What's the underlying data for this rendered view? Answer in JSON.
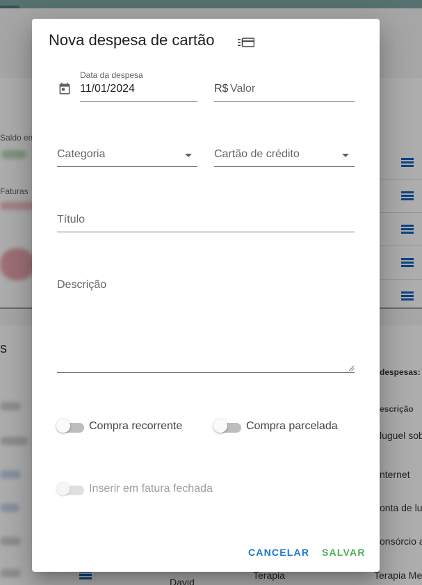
{
  "background": {
    "saldo_label": "Saldo em",
    "faturas_label": "Faturas",
    "section_letter": "s",
    "despesas_label": "despesas: R$",
    "descricao_header": "escrição",
    "rows": [
      "luguel sob",
      "nternet",
      "onta de lu",
      "onsórcio a",
      "Terapia Me"
    ],
    "row_category": "Terapia",
    "row_name": "David",
    "accent_color": "#1565c0"
  },
  "dialog": {
    "title": "Nova despesa de cartão",
    "title_icon": "card-list-icon",
    "date": {
      "label": "Data da despesa",
      "value": "11/01/2024",
      "icon": "calendar-icon"
    },
    "amount": {
      "prefix": "R$",
      "placeholder": "Valor"
    },
    "category": {
      "placeholder": "Categoria"
    },
    "credit_card": {
      "placeholder": "Cartão de crédito"
    },
    "title_field": {
      "placeholder": "Título"
    },
    "description": {
      "placeholder": "Descrição"
    },
    "switches": {
      "recurring": {
        "label": "Compra recorrente",
        "on": false
      },
      "installments": {
        "label": "Compra parcelada",
        "on": false
      },
      "closed_invoice": {
        "label": "Inserir em fatura fechada",
        "on": false,
        "disabled": true
      }
    },
    "actions": {
      "cancel": "Cancelar",
      "save": "Salvar"
    },
    "colors": {
      "cancel": "#1976d2",
      "save": "#4caf50"
    }
  }
}
